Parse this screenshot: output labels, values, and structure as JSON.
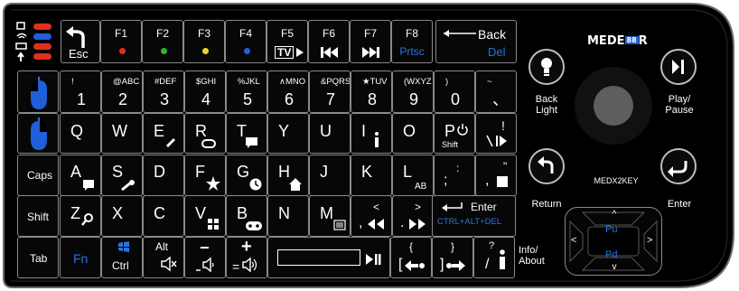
{
  "brand": "MEDE",
  "brand_suffix": "R",
  "model": "MEDX2KEY",
  "indicator_colors": [
    "#e0301e",
    "#1f5fd8",
    "#e0301e",
    "#e0301e"
  ],
  "fn_row": [
    {
      "label": "F1",
      "dot": "#e0301e"
    },
    {
      "label": "F2",
      "dot": "#2fb52f"
    },
    {
      "label": "F3",
      "dot": "#f0d020"
    },
    {
      "label": "F4",
      "dot": "#1f5fd8"
    },
    {
      "label": "F5",
      "sub": "TV"
    },
    {
      "label": "F6"
    },
    {
      "label": "F7"
    },
    {
      "label": "F8",
      "sub": "Prtsc"
    }
  ],
  "esc": "Esc",
  "back": {
    "label": "Back",
    "sub": "Del"
  },
  "num_row": [
    {
      "top": "!",
      "main": "1"
    },
    {
      "top": "@ABC",
      "main": "2"
    },
    {
      "top": "#DEF",
      "main": "3"
    },
    {
      "top": "$GHI",
      "main": "4"
    },
    {
      "top": "%JKL",
      "main": "5"
    },
    {
      "top": "∧MNO",
      "main": "6"
    },
    {
      "top": "&PQRS",
      "main": "7"
    },
    {
      "top": "★TUV",
      "main": "8"
    },
    {
      "top": "(WXYZ",
      "main": "9"
    },
    {
      "top": ")",
      "main": "0"
    },
    {
      "top": "~",
      "main": "、"
    }
  ],
  "q_row": [
    "Q",
    "W",
    "E",
    "R",
    "T",
    "Y",
    "U",
    "I",
    "O",
    "P",
    "!"
  ],
  "shift_on_p": "Shift",
  "caps": "Caps",
  "a_row": [
    "A",
    "S",
    "D",
    "F",
    "G",
    "H",
    "J",
    "K",
    "L",
    ";",
    ","
  ],
  "l_sub": "AB",
  "semicolon_top": ":",
  "comma_top": "\"",
  "shift": "Shift",
  "z_row": [
    "Z",
    "X",
    "C",
    "V",
    "B",
    "N",
    "M",
    ",",
    "."
  ],
  "comma_top2": "<",
  "period_top": ">",
  "enter": {
    "label": "Enter",
    "sub": "CTRL+ALT+DEL"
  },
  "tab": "Tab",
  "fn": "Fn",
  "ctrl": "Ctrl",
  "alt": "Alt",
  "vol_down": "−",
  "vol_up": "+",
  "vol_eq": "=",
  "brace_open": "{",
  "brace_close": "}",
  "bracket_open": "[",
  "bracket_close": "]",
  "question": "?",
  "slash": "/",
  "right_panel": {
    "back_light": "Back\nLight",
    "play_pause": "Play/\nPause",
    "return": "Return",
    "enter": "Enter",
    "info_about": "Info/\nAbout",
    "pu": "Pu",
    "pd": "Pd"
  }
}
